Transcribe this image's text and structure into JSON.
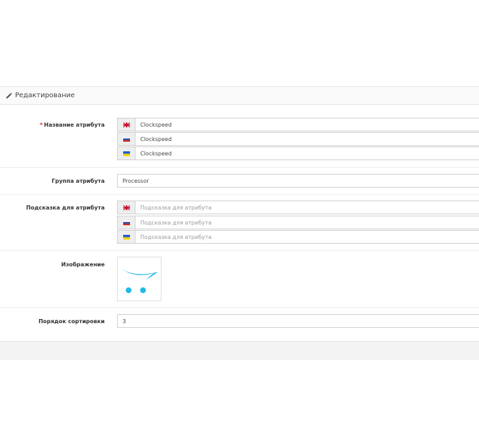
{
  "panel": {
    "title": "Редактирование",
    "icon": "pencil-icon"
  },
  "form": {
    "name": {
      "label": "Название атрибута",
      "required_mark": "*",
      "rows": [
        {
          "flag": "en-flag-icon",
          "value": "Clockspeed"
        },
        {
          "flag": "ru-flag-icon",
          "value": "Clockspeed"
        },
        {
          "flag": "ua-flag-icon",
          "value": "Clockspeed"
        }
      ]
    },
    "group": {
      "label": "Группа атрибута",
      "value": "Processor"
    },
    "hint": {
      "label": "Подсказка для атрибута",
      "rows": [
        {
          "flag": "en-flag-icon",
          "placeholder": "Подсказка для атрибута"
        },
        {
          "flag": "ru-flag-icon",
          "placeholder": "Подсказка для атрибута"
        },
        {
          "flag": "ua-flag-icon",
          "placeholder": "Подсказка для атрибута"
        }
      ]
    },
    "image": {
      "label": "Изображение",
      "thumbnail": "cart-logo-icon"
    },
    "sort": {
      "label": "Порядок сортировки",
      "value": "3"
    }
  },
  "colors": {
    "accent": "#23b9e6",
    "required": "#e2231a",
    "border": "#cfcfcf"
  }
}
